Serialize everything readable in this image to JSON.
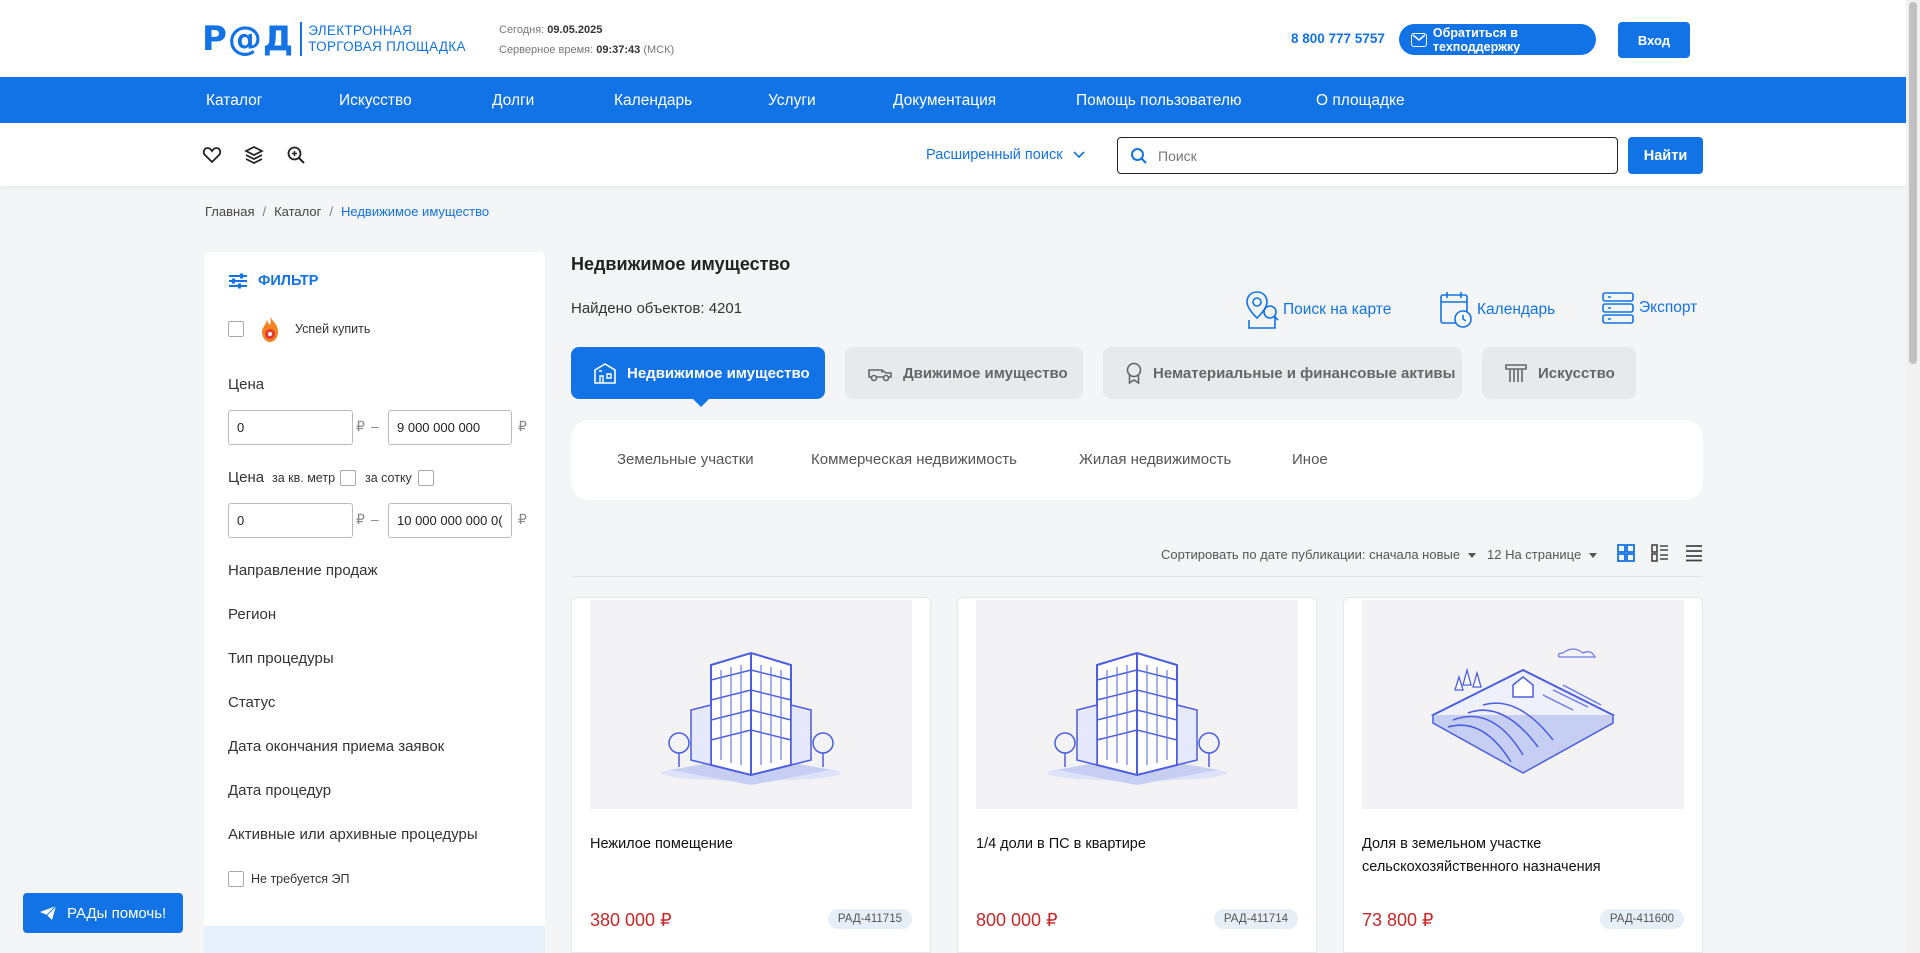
{
  "header": {
    "logo_mark": "Р@Д",
    "logo_line1": "ЭЛЕКТРОННАЯ",
    "logo_line2": "ТОРГОВАЯ ПЛОЩАДКА",
    "today_label": "Сегодня:",
    "today_value": "09.05.2025",
    "server_time_label": "Серверное время:",
    "server_time_value": "09:37:43",
    "timezone": "(МСК)",
    "phone": "8 800 777 5757",
    "support_button": "Обратиться в техподдержку",
    "login_button": "Вход"
  },
  "nav": {
    "items": [
      "Каталог",
      "Искусство",
      "Долги",
      "Календарь",
      "Услуги",
      "Документация",
      "Помощь пользователю",
      "О площадке"
    ]
  },
  "toolbar": {
    "advanced_search": "Расширенный поиск",
    "search_placeholder": "Поиск",
    "search_value": "",
    "find_button": "Найти"
  },
  "breadcrumb": {
    "items": [
      "Главная",
      "Каталог",
      "Недвижимое имущество"
    ]
  },
  "filter": {
    "title": "ФИЛЬТР",
    "hurry_label": "Успей купить",
    "hurry_checked": false,
    "price_label": "Цена",
    "price_from": "0",
    "price_to": "9 000 000 000",
    "currency": "₽",
    "dash": "–",
    "unit_price_label": "Цена",
    "per_sqm_label": "за кв. метр",
    "per_sotka_label": "за сотку",
    "unit_price_from": "0",
    "unit_price_to": "10 000 000 000 0(",
    "sections": [
      "Направление продаж",
      "Регион",
      "Тип процедуры",
      "Статус",
      "Дата окончания приема заявок",
      "Дата процедур",
      "Активные или архивные процедуры"
    ],
    "no_signature_label": "Не требуется ЭП",
    "no_signature_checked": false
  },
  "help_button": "РАДы помочь!",
  "main": {
    "title": "Недвижимое имущество",
    "found_label": "Найдено объектов:",
    "found_count": "4201",
    "actions": {
      "map": "Поиск на карте",
      "calendar": "Календарь",
      "export": "Экспорт"
    },
    "category_tabs": [
      "Недвижимое имущество",
      "Движимое имущество",
      "Нематериальные и финансовые активы",
      "Искусство"
    ],
    "active_tab": "Недвижимое имущество",
    "subcategories": [
      "Земельные участки",
      "Коммерческая недвижимость",
      "Жилая недвижимость",
      "Иное"
    ],
    "sort_label": "Сортировать по дате публикации: сначала новые",
    "per_page_label": "12 На странице",
    "cards": [
      {
        "title": "Нежилое помещение",
        "price": "380 000 ₽",
        "id": "РАД-411715",
        "image": "building"
      },
      {
        "title": "1/4 доли в ПС в квартире",
        "price": "800 000 ₽",
        "id": "РАД-411714",
        "image": "building"
      },
      {
        "title": "Доля в земельном участке сельскохозяйственного назначения",
        "price": "73 800 ₽",
        "id": "РАД-411600",
        "image": "land"
      }
    ]
  },
  "colors": {
    "brand_blue": "#1273e6",
    "price_red": "#c62828",
    "page_bg": "#f4f5f7"
  }
}
